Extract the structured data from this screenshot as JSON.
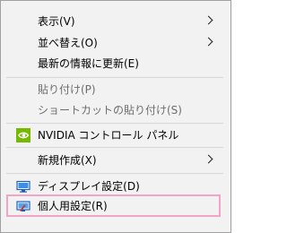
{
  "menu": {
    "items": [
      {
        "label": "表示(V)"
      },
      {
        "label": "並べ替え(O)"
      },
      {
        "label": "最新の情報に更新(E)"
      },
      {
        "label": "貼り付け(P)"
      },
      {
        "label": "ショートカットの貼り付け(S)"
      },
      {
        "label": "NVIDIA コントロール パネル",
        "icon": "nvidia-icon"
      },
      {
        "label": "新規作成(X)"
      },
      {
        "label": "ディスプレイ設定(D)",
        "icon": "display-settings-icon"
      },
      {
        "label": "個人用設定(R)",
        "icon": "personalize-icon"
      }
    ]
  },
  "colors": {
    "menu_bg": "#f2f2f2",
    "border": "#a0a0a0",
    "disabled_text": "#6d6d6d",
    "separator": "#d7d7d7",
    "highlight": "#f2a4c6",
    "nvidia_green": "#76b900",
    "icon_blue": "#1e5fb4"
  }
}
